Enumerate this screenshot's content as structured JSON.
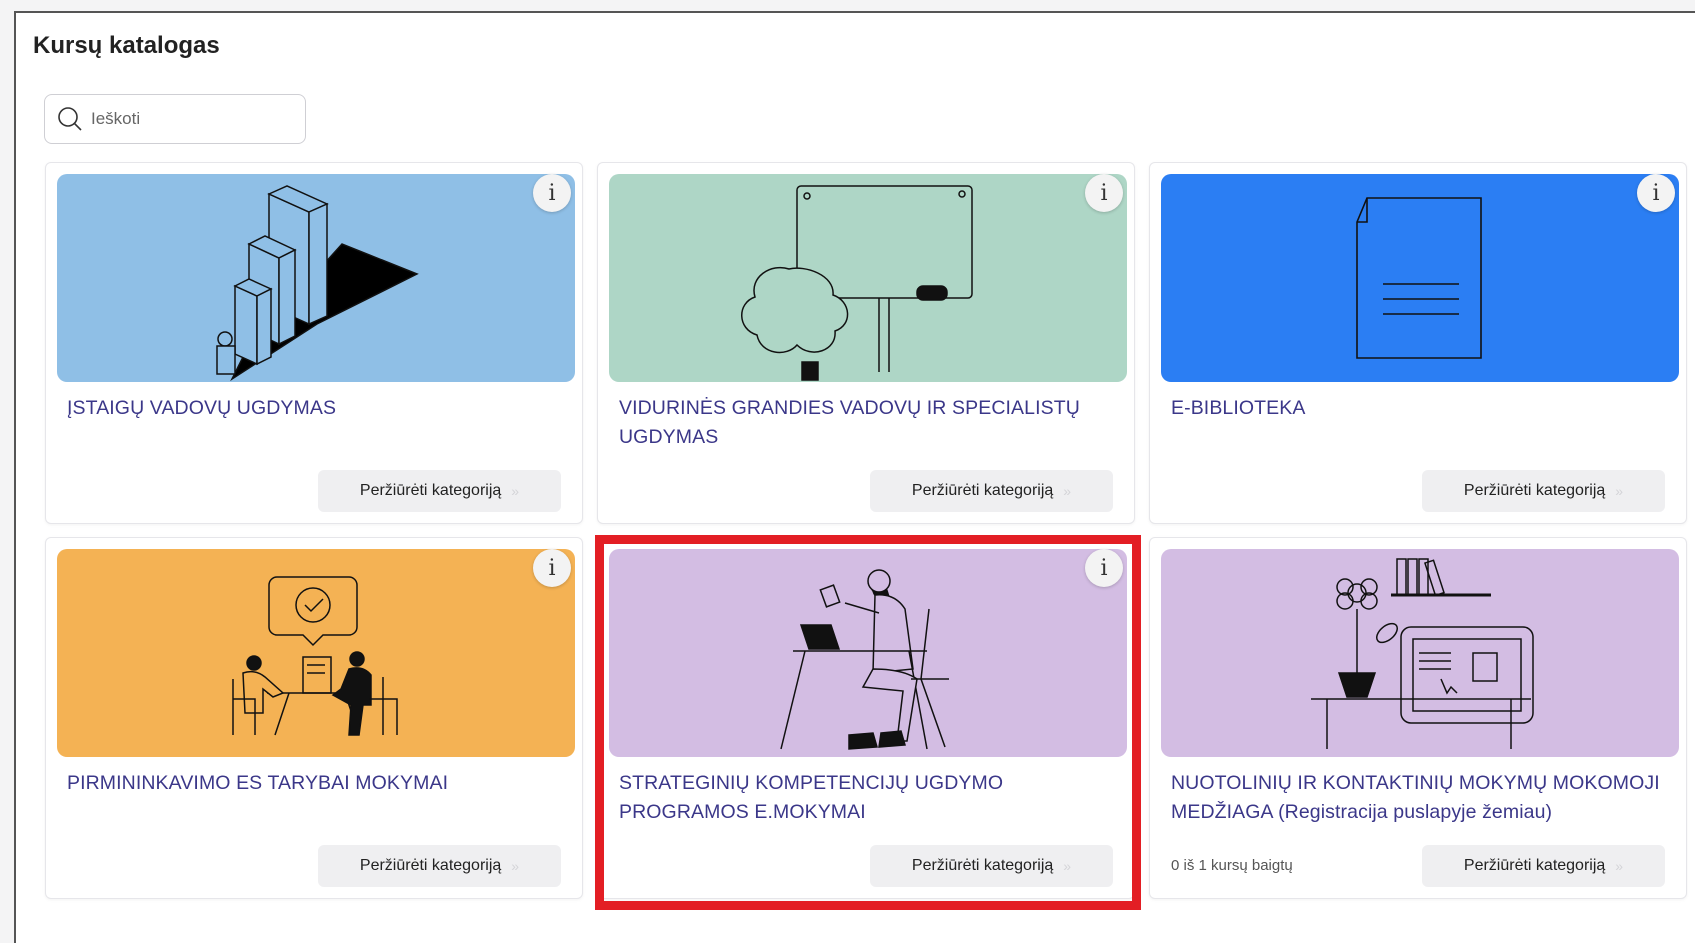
{
  "page": {
    "title": "Kursų katalogas",
    "search_placeholder": "Ieškoti"
  },
  "cards": [
    {
      "title": "ĮSTAIGŲ VADOVŲ UGDYMAS",
      "button": "Peržiūrėti kategoriją",
      "bg": "#8fbfe6"
    },
    {
      "title": "VIDURINĖS GRANDIES VADOVŲ IR SPECIALISTŲ UGDYMAS",
      "button": "Peržiūrėti kategoriją",
      "bg": "#aed6c6"
    },
    {
      "title": "E-BIBLIOTEKA",
      "button": "Peržiūrėti kategoriją",
      "bg": "#2b7ef3"
    },
    {
      "title": "PIRMININKAVIMO ES TARYBAI MOKYMAI",
      "button": "Peržiūrėti kategoriją",
      "bg": "#f4b254"
    },
    {
      "title": "STRATEGINIŲ KOMPETENCIJŲ UGDYMO PROGRAMOS E.MOKYMAI",
      "button": "Peržiūrėti kategoriją",
      "bg": "#d3bde3"
    },
    {
      "title": "NUOTOLINIŲ IR KONTAKTINIŲ MOKYMŲ MOKOMOJI MEDŽIAGA (Registracija puslapyje žemiau)",
      "button": "Peržiūrėti kategoriją",
      "bg": "#d3bde3",
      "progress": "0 iš 1 kursų baigtų"
    }
  ],
  "info_glyph": "i",
  "chevron_glyph": "»",
  "highlight_color": "#e31e24"
}
